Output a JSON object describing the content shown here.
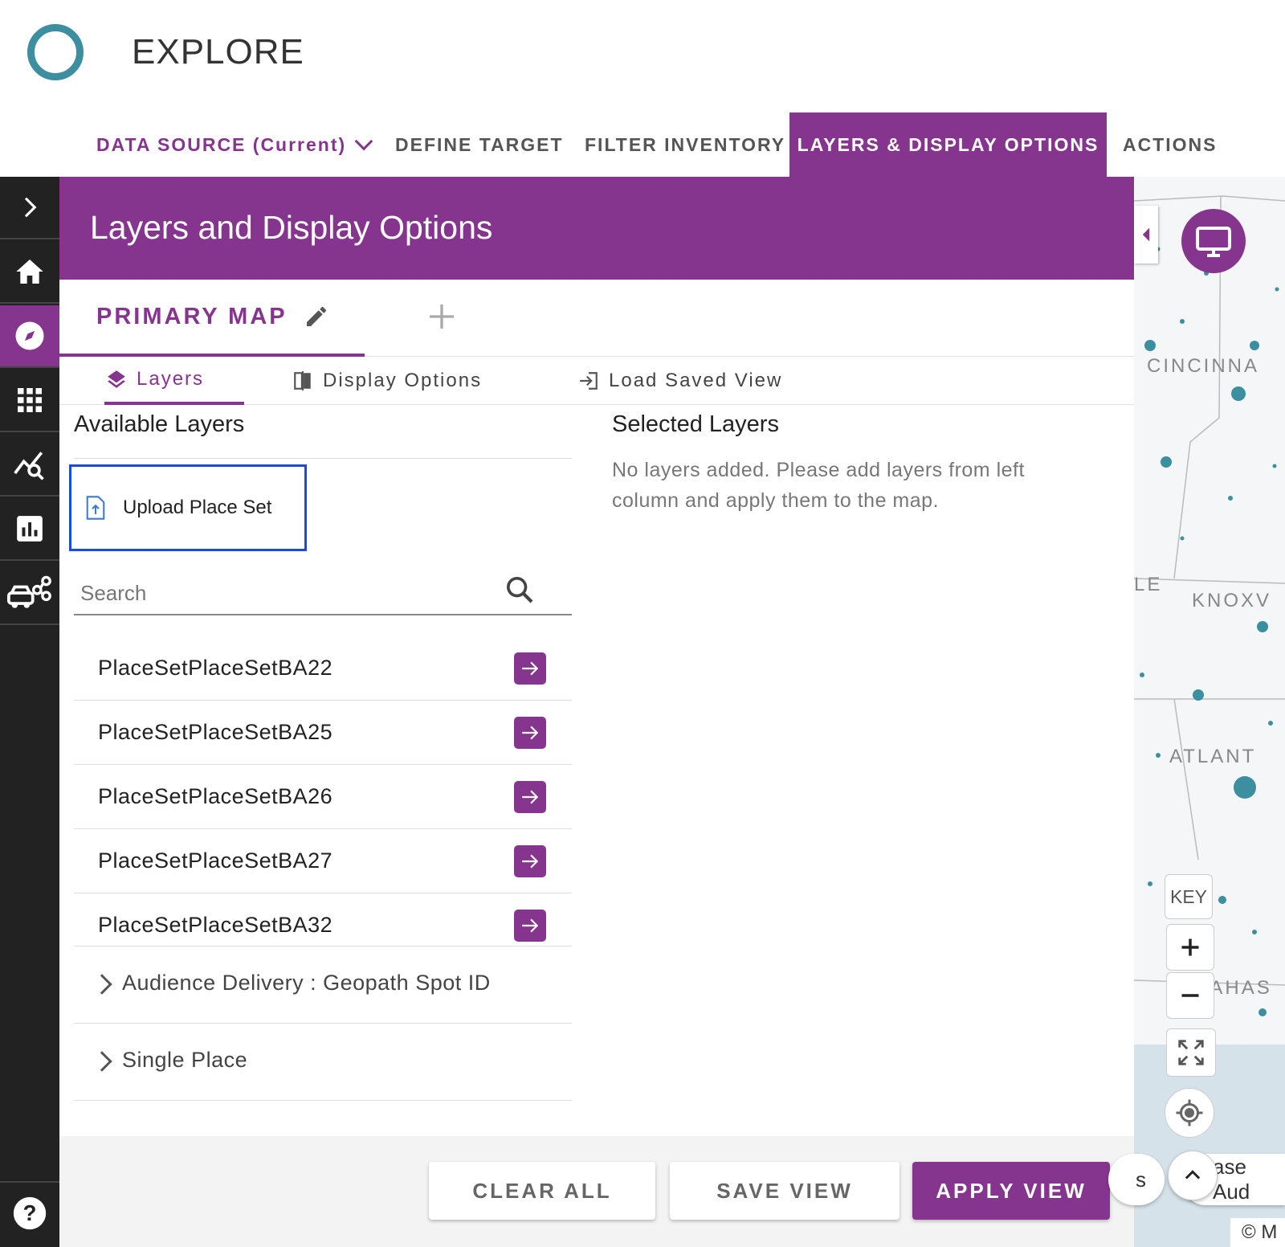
{
  "app": {
    "title": "EXPLORE"
  },
  "topnav": {
    "data_source": "DATA SOURCE (Current)",
    "define_target": "DEFINE TARGET",
    "filter_inventory": "FILTER INVENTORY",
    "layers_display": "LAYERS & DISPLAY OPTIONS",
    "actions": "ACTIONS"
  },
  "panel": {
    "title": "Layers and Display Options",
    "map_tab": "PRIMARY MAP",
    "subtabs": {
      "layers": "Layers",
      "display": "Display Options",
      "load": "Load Saved View"
    }
  },
  "available": {
    "title": "Available Layers",
    "upload_label": "Upload Place Set",
    "search_placeholder": "Search",
    "items": [
      "PlaceSetPlaceSetBA22",
      "PlaceSetPlaceSetBA25",
      "PlaceSetPlaceSetBA26",
      "PlaceSetPlaceSetBA27",
      "PlaceSetPlaceSetBA32"
    ],
    "groups": [
      "Audience Delivery : Geopath Spot ID",
      "Single Place"
    ]
  },
  "selected": {
    "title": "Selected Layers",
    "empty_message": "No layers added. Please add layers from left column and apply them to the map."
  },
  "footer": {
    "clear": "CLEAR ALL",
    "save": "SAVE VIEW",
    "apply": "APPLY VIEW"
  },
  "map": {
    "cities": [
      "CINCINNA",
      "LE",
      "KNOXV",
      "ATLANT",
      "LAHAS"
    ],
    "key_label": "KEY",
    "pill_left": "s",
    "pill_right": "ase Aud",
    "copyright": "© M"
  },
  "colors": {
    "brand": "#86358f",
    "accent": "#3d8ea0",
    "rail": "#222222",
    "focus": "#1a4be0"
  }
}
